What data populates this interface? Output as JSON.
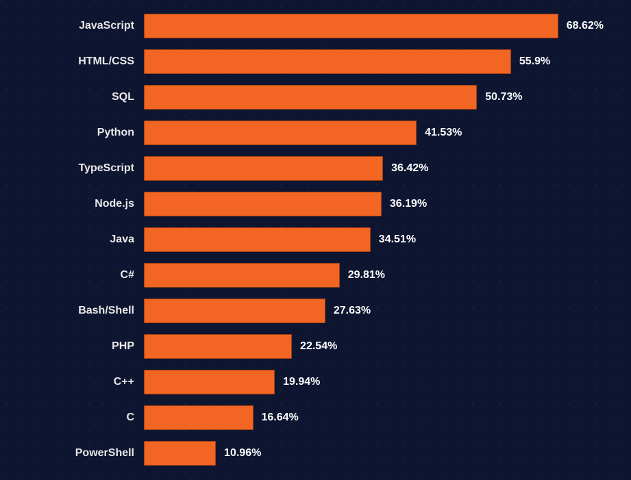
{
  "chart_data": {
    "type": "bar",
    "orientation": "horizontal",
    "categories": [
      "JavaScript",
      "HTML/CSS",
      "SQL",
      "Python",
      "TypeScript",
      "Node.js",
      "Java",
      "C#",
      "Bash/Shell",
      "PHP",
      "C++",
      "C",
      "PowerShell"
    ],
    "values": [
      68.62,
      55.9,
      50.73,
      41.53,
      36.42,
      36.19,
      34.51,
      29.81,
      27.63,
      22.54,
      19.94,
      16.64,
      10.96
    ],
    "value_labels": [
      "68.62%",
      "55.9%",
      "50.73%",
      "41.53%",
      "36.42%",
      "36.19%",
      "34.51%",
      "29.81%",
      "27.63%",
      "22.54%",
      "19.94%",
      "16.64%",
      "10.96%"
    ],
    "xlim": [
      0,
      70
    ],
    "title": "",
    "xlabel": "",
    "ylabel": "",
    "bar_color": "#f26522",
    "background_color": "#0e1530"
  }
}
